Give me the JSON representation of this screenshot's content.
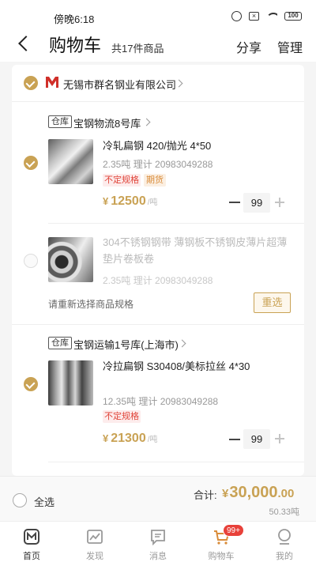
{
  "status_bar": {
    "time": "傍晚6:18",
    "battery": "100"
  },
  "header": {
    "title": "购物车",
    "count": "共17件商品",
    "share": "分享",
    "manage": "管理"
  },
  "shop": {
    "name": "无锡市群名钢业有限公司"
  },
  "warehouses": [
    {
      "tag": "仓库",
      "name": "宝钢物流8号库"
    },
    {
      "tag": "仓库",
      "name": "宝钢运输1号库(上海市)"
    }
  ],
  "products": [
    {
      "name": "冷轧扁钢 420/抛光 4*50",
      "meta": "2.35吨  理计  20983049288",
      "tag1": "不定规格",
      "tag2": "期货",
      "currency": "¥",
      "price": "12500",
      "unit": "/吨",
      "qty": "99",
      "checked": true
    },
    {
      "name": "304不锈钢钢带 薄钢板不锈钢皮薄片超薄垫片卷板卷",
      "meta": "2.35吨  理计  20983049288",
      "invalid_hint": "请重新选择商品规格",
      "reselect": "重选",
      "checked": false
    },
    {
      "name": "冷拉扁钢 S30408/美标拉丝 4*30",
      "meta": "12.35吨  理计  20983049288",
      "tag1": "不定规格",
      "currency": "¥",
      "price": "21300",
      "unit": "/吨",
      "qty": "99",
      "checked": true
    }
  ],
  "footer": {
    "select_all": "全选",
    "total_label": "合计:",
    "total_currency": "¥",
    "total_int": "30,000",
    "total_dec": ".00",
    "total_weight": "50.33吨"
  },
  "tabs": [
    {
      "label": "首页",
      "icon": "home-icon"
    },
    {
      "label": "发现",
      "icon": "discover-icon"
    },
    {
      "label": "消息",
      "icon": "message-icon"
    },
    {
      "label": "购物车",
      "icon": "cart-icon",
      "badge": "99+"
    },
    {
      "label": "我的",
      "icon": "profile-icon"
    }
  ],
  "colors": {
    "accent": "#c9a254",
    "badge": "#e8413a",
    "tag_red": "#e0453a",
    "tag_orange": "#d98c3a"
  }
}
